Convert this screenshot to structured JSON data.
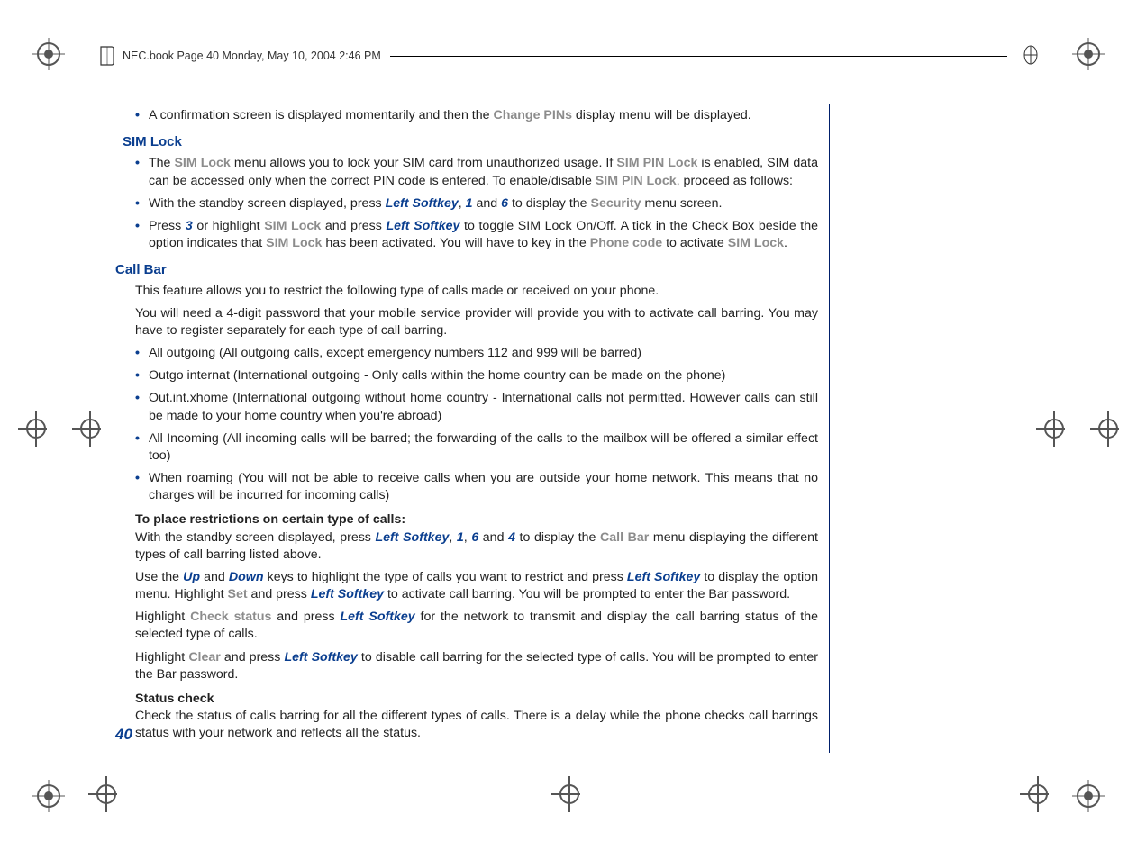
{
  "header": {
    "text": "NEC.book  Page 40  Monday, May 10, 2004  2:46 PM"
  },
  "page_number": "40",
  "sections": {
    "confirm_bullet": {
      "pre": "A confirmation screen is displayed momentarily and then the ",
      "gray1": "Change PINs",
      "post": " display menu will be displayed."
    },
    "sim_lock": {
      "heading": "SIM Lock",
      "b1": {
        "t1": "The ",
        "g1": "SIM Lock",
        "t2": " menu allows you to lock your SIM card from unauthorized usage. If ",
        "g2": "SIM PIN Lock",
        "t3": " is enabled, SIM data can be accessed only when the correct PIN code is entered. To enable/disable ",
        "g3": "SIM PIN Lock",
        "t4": ", proceed as follows:"
      },
      "b2": {
        "t1": "With the standby screen displayed, press ",
        "k1": "Left Softkey",
        "t2": ", ",
        "k2": "1",
        "t3": " and ",
        "k3": "6",
        "t4": " to display the ",
        "g1": "Security",
        "t5": " menu screen."
      },
      "b3": {
        "t1": "Press ",
        "k1": "3",
        "t2": " or highlight ",
        "g1": "SIM Lock",
        "t3": " and press ",
        "k2": "Left Softkey",
        "t4": " to toggle SIM Lock On/Off. A tick in the Check Box beside the option indicates that ",
        "g2": "SIM Lock",
        "t5": " has been activated. You will have to key in the ",
        "g3": "Phone code",
        "t6": " to activate ",
        "g4": "SIM Lock",
        "t7": "."
      }
    },
    "call_bar": {
      "heading": "Call Bar",
      "p1": "This feature allows you to restrict the following type of calls made or received on your phone.",
      "p2": "You will need a 4-digit password that your mobile service provider will provide you with to activate call barring. You may have to register separately for each type of call barring.",
      "b1": "All outgoing (All outgoing calls, except emergency numbers 112 and 999 will be barred)",
      "b2": "Outgo internat (International outgoing - Only calls within the home country can be made on the phone)",
      "b3": "Out.int.xhome (International outgoing without home country - International calls not permitted. However calls can still be made to your home country when you're abroad)",
      "b4": "All Incoming (All incoming calls will be barred; the forwarding of the calls to the mailbox will be offered a similar effect too)",
      "b5": "When roaming (You will not be able to receive calls when you are outside your home network. This means that no charges will be incurred for incoming calls)",
      "sub1": "To place restrictions on certain type of calls:",
      "p3": {
        "t1": "With the standby screen displayed, press ",
        "k1": "Left Softkey",
        "t2": ", ",
        "k2": "1",
        "t3": ", ",
        "k3": "6",
        "t4": " and ",
        "k4": "4",
        "t5": " to display the ",
        "g1": "Call Bar",
        "t6": " menu displaying the different types of call barring listed above."
      },
      "p4": {
        "t1": "Use the ",
        "k1": "Up",
        "t2": " and ",
        "k2": "Down",
        "t3": " keys to highlight the type of calls you want to restrict and press ",
        "k3": "Left Softkey",
        "t4": " to display the option menu. Highlight ",
        "g1": "Set",
        "t5": " and press ",
        "k4": "Left Softkey",
        "t6": " to activate call barring. You will be prompted to enter the Bar password."
      },
      "p5": {
        "t1": "Highlight ",
        "g1": "Check status",
        "t2": " and press ",
        "k1": "Left Softkey",
        "t3": " for the network to transmit and display the call barring status of the selected type of calls."
      },
      "p6": {
        "t1": "Highlight ",
        "g1": "Clear",
        "t2": " and press ",
        "k1": "Left Softkey",
        "t3": " to disable call barring for the selected type of calls. You will be prompted to enter the Bar password."
      },
      "sub2": "Status check",
      "p7": "Check the status of calls barring for all the different types of calls. There is a delay while the phone checks call barrings status with your network and reflects all the status."
    }
  }
}
